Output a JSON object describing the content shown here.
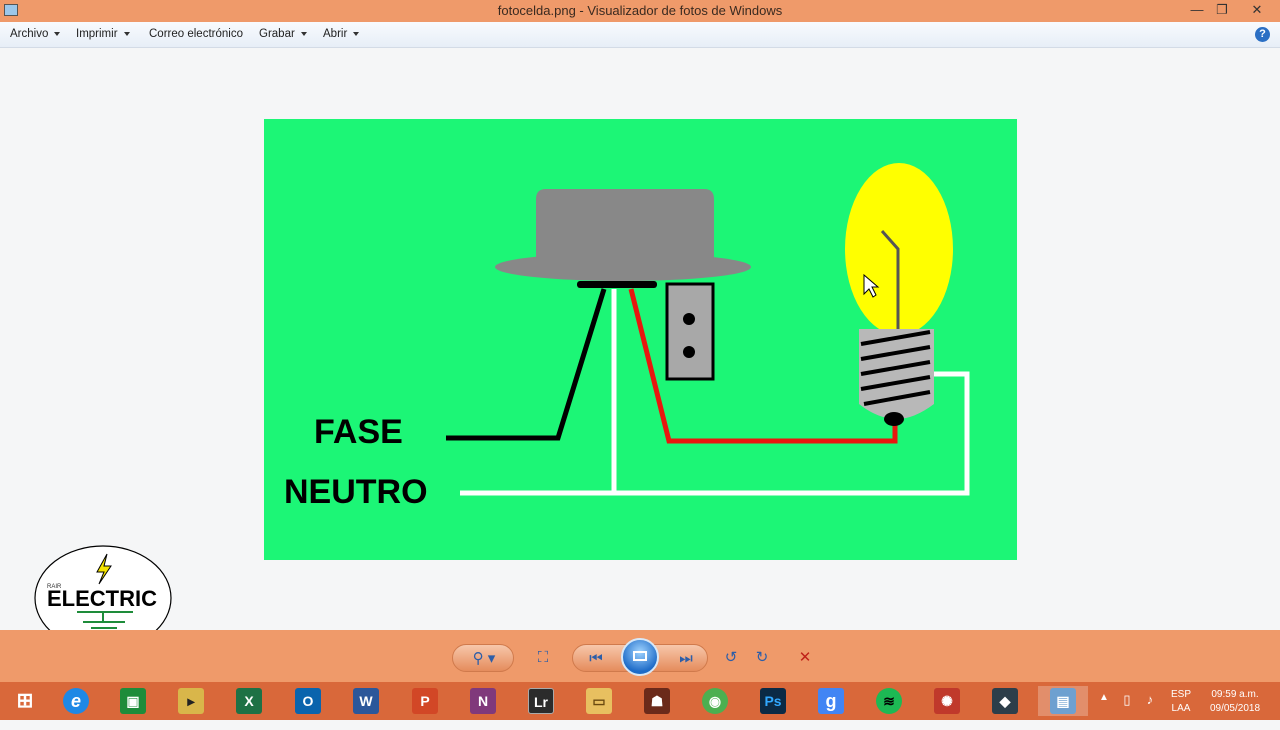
{
  "window": {
    "title": "fotocelda.png - Visualizador de fotos de Windows",
    "minimize": "—",
    "restore": "❐",
    "close": "✕"
  },
  "menu": [
    {
      "label": "Archivo",
      "has_caret": true
    },
    {
      "label": "Imprimir",
      "has_caret": true
    },
    {
      "label": "Correo electrónico",
      "has_caret": false
    },
    {
      "label": "Grabar",
      "has_caret": true
    },
    {
      "label": "Abrir",
      "has_caret": true
    }
  ],
  "help": "?",
  "photo": {
    "background": "#1cf676",
    "labels": {
      "fase": "FASE",
      "neutro": "NEUTRO"
    },
    "wire_colors": {
      "fase": "#000000",
      "neutro": "#ffffff",
      "load": "#e8170f"
    },
    "bulb_color": "#ffff00"
  },
  "logo": {
    "small_text": "RAIR",
    "text": "ELECTRIC"
  },
  "controls": {
    "zoom": "zoom-icon",
    "fit": "actual-size-icon",
    "previous": "previous-icon",
    "slideshow": "slideshow-icon",
    "next": "next-icon",
    "rotate_left": "rotate-ccw-icon",
    "rotate_right": "rotate-cw-icon",
    "delete": "delete-icon"
  },
  "taskbar": {
    "apps": [
      {
        "name": "start",
        "glyph": "⊞",
        "color": "#ffffff"
      },
      {
        "name": "internet-explorer",
        "glyph": "e",
        "color": "#1e88e5"
      },
      {
        "name": "store",
        "glyph": "▣",
        "color": "#1e8c3a"
      },
      {
        "name": "labview",
        "glyph": "▸",
        "color": "#d9b64a"
      },
      {
        "name": "excel",
        "glyph": "X",
        "color": "#1e7145"
      },
      {
        "name": "outlook",
        "glyph": "O",
        "color": "#0a64ad"
      },
      {
        "name": "word",
        "glyph": "W",
        "color": "#2b579a"
      },
      {
        "name": "powerpoint",
        "glyph": "P",
        "color": "#d24726"
      },
      {
        "name": "onenote",
        "glyph": "N",
        "color": "#80397b"
      },
      {
        "name": "lightroom",
        "glyph": "Lr",
        "color": "#2b2b2b"
      },
      {
        "name": "file-explorer",
        "glyph": "▭",
        "color": "#e8c060"
      },
      {
        "name": "game",
        "glyph": "☗",
        "color": "#6b2a1a"
      },
      {
        "name": "chrome",
        "glyph": "◉",
        "color": "#4caf50"
      },
      {
        "name": "photoshop",
        "glyph": "Ps",
        "color": "#0b2a45"
      },
      {
        "name": "google",
        "glyph": "g",
        "color": "#4285f4"
      },
      {
        "name": "spotify",
        "glyph": "≋",
        "color": "#1db954"
      },
      {
        "name": "cade-simu",
        "glyph": "✺",
        "color": "#c0392b"
      },
      {
        "name": "editor",
        "glyph": "◆",
        "color": "#2d3e4a"
      },
      {
        "name": "photo-viewer",
        "glyph": "▤",
        "color": "#6ea0d0"
      }
    ],
    "tray": {
      "lang_top": "ESP",
      "lang_bottom": "LAA",
      "time": "09:59 a.m.",
      "date": "09/05/2018",
      "show_hidden": "▲"
    }
  },
  "colors": {
    "titlebar": "#ef9a6a",
    "taskbar": "#d9683a"
  }
}
